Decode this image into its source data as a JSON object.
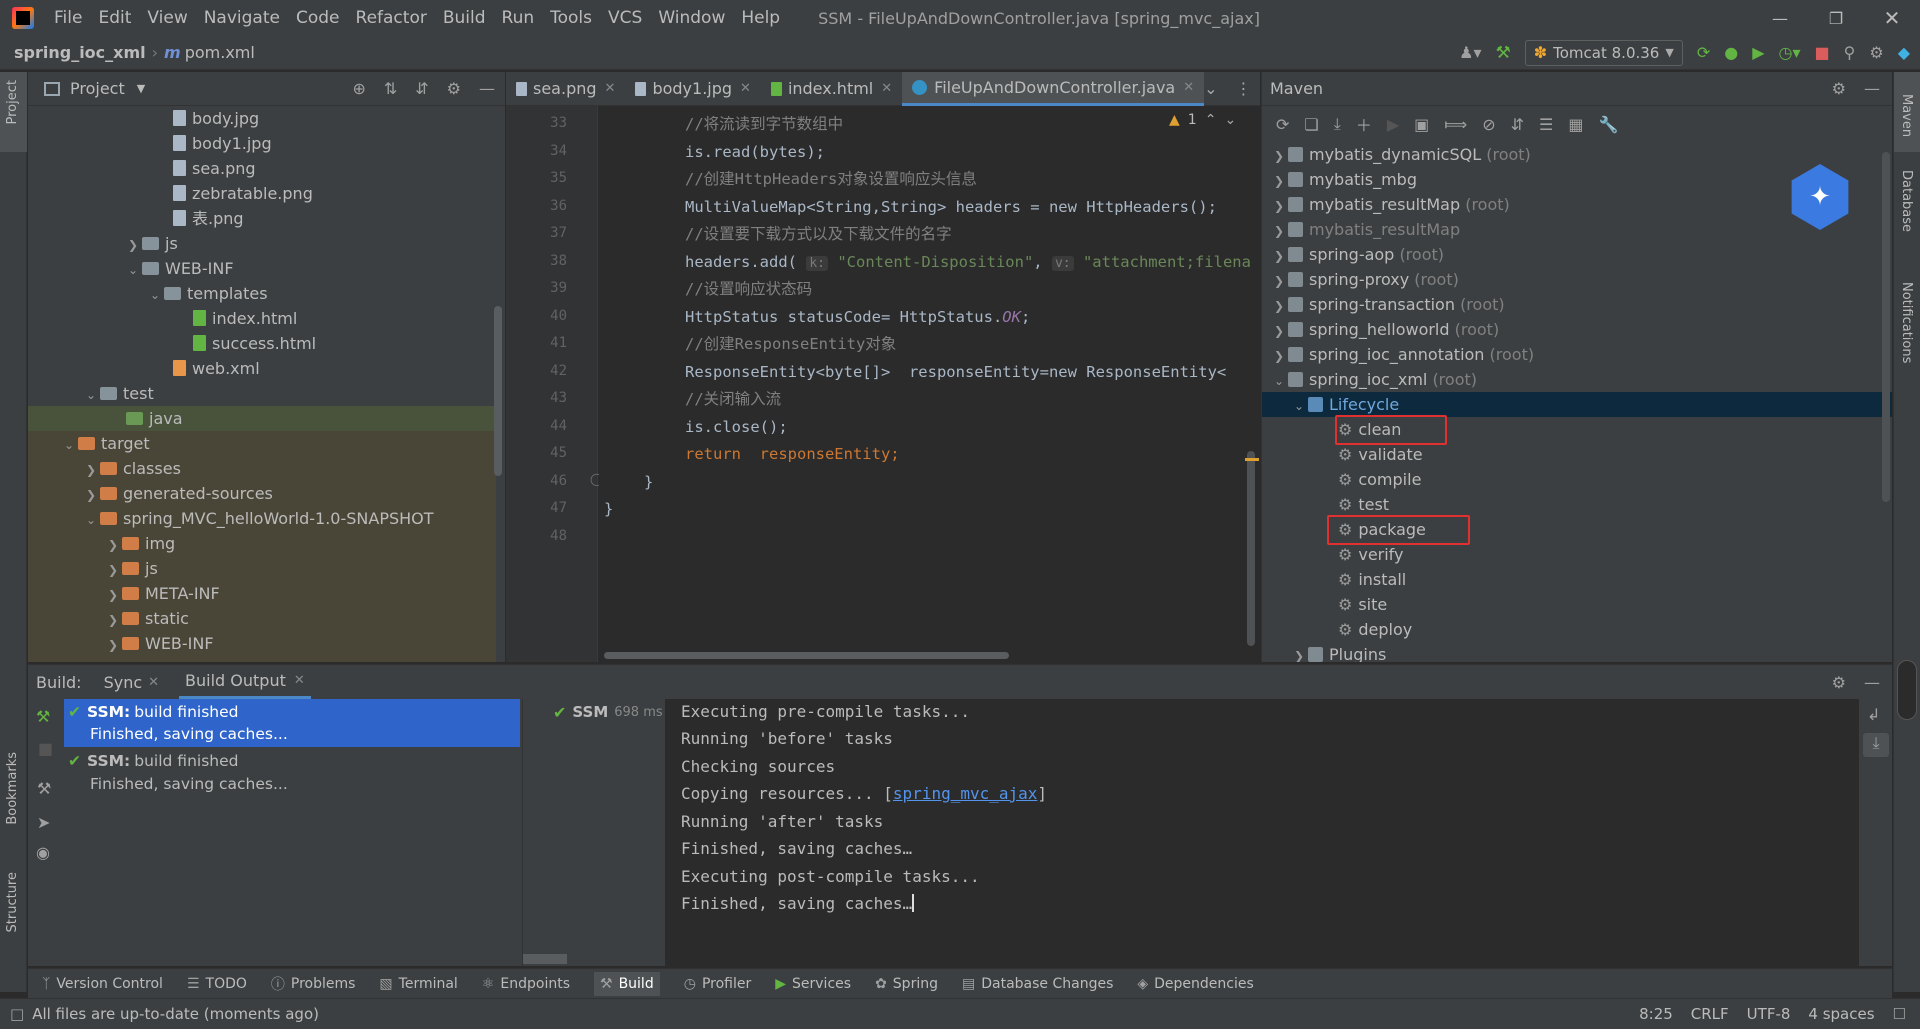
{
  "window": {
    "title": "SSM - FileUpAndDownController.java [spring_mvc_ajax]"
  },
  "menu": [
    "File",
    "Edit",
    "View",
    "Navigate",
    "Code",
    "Refactor",
    "Build",
    "Run",
    "Tools",
    "VCS",
    "Window",
    "Help"
  ],
  "breadcrumb": {
    "project": "spring_ioc_xml",
    "file": "pom.xml"
  },
  "run_config": "Tomcat 8.0.36",
  "project_panel": {
    "title": "Project",
    "tree": [
      {
        "label": "body.jpg",
        "kind": "file"
      },
      {
        "label": "body1.jpg",
        "kind": "file"
      },
      {
        "label": "sea.png",
        "kind": "file"
      },
      {
        "label": "zebratable.png",
        "kind": "file"
      },
      {
        "label": "表.png",
        "kind": "file"
      },
      {
        "label": "js",
        "kind": "folder"
      },
      {
        "label": "WEB-INF",
        "kind": "folder"
      },
      {
        "label": "templates",
        "kind": "folder"
      },
      {
        "label": "index.html",
        "kind": "html"
      },
      {
        "label": "success.html",
        "kind": "html"
      },
      {
        "label": "web.xml",
        "kind": "file"
      },
      {
        "label": "test",
        "kind": "folder"
      },
      {
        "label": "java",
        "kind": "folder"
      },
      {
        "label": "target",
        "kind": "folder"
      },
      {
        "label": "classes",
        "kind": "folder"
      },
      {
        "label": "generated-sources",
        "kind": "folder"
      },
      {
        "label": "spring_MVC_helloWorld-1.0-SNAPSHOT",
        "kind": "folder"
      },
      {
        "label": "img",
        "kind": "folder"
      },
      {
        "label": "js",
        "kind": "folder"
      },
      {
        "label": "META-INF",
        "kind": "folder"
      },
      {
        "label": "static",
        "kind": "folder"
      },
      {
        "label": "WEB-INF",
        "kind": "folder"
      }
    ]
  },
  "editor": {
    "tabs": [
      "sea.png",
      "body1.jpg",
      "index.html",
      "FileUpAndDownController.java"
    ],
    "active_tab": "FileUpAndDownController.java",
    "warning_count": "1",
    "line_numbers": [
      "33",
      "34",
      "35",
      "36",
      "37",
      "38",
      "39",
      "40",
      "41",
      "42",
      "43",
      "44",
      "45",
      "46",
      "47",
      "48"
    ],
    "lines": [
      "//将流读到字节数组中",
      "is.read(bytes);",
      "//创建HttpHeaders对象设置响应头信息",
      "MultiValueMap<String,String> headers = new HttpHeaders();",
      "//设置要下载方式以及下载文件的名字",
      "headers.add(",
      "//设置响应状态码",
      "HttpStatus statusCode= HttpStatus.",
      "//创建ResponseEntity对象",
      "ResponseEntity<byte[]>  responseEntity=new ResponseEntity<",
      "//关闭输入流",
      "is.close();",
      "return  responseEntity;",
      "}",
      "}"
    ],
    "hint_k": "k:",
    "hint_v": "v:",
    "str_disposition": "\"Content-Disposition\"",
    "str_attachment": "\"attachment;filena",
    "ok_const": "OK"
  },
  "maven": {
    "title": "Maven",
    "projects": [
      {
        "name": "mybatis_dynamicSQL",
        "suffix": "(root)"
      },
      {
        "name": "mybatis_mbg",
        "suffix": ""
      },
      {
        "name": "mybatis_resultMap",
        "suffix": "(root)"
      },
      {
        "name": "mybatis_resultMap",
        "suffix": ""
      },
      {
        "name": "spring-aop",
        "suffix": "(root)"
      },
      {
        "name": "spring-proxy",
        "suffix": "(root)"
      },
      {
        "name": "spring-transaction",
        "suffix": "(root)"
      },
      {
        "name": "spring_helloworld",
        "suffix": "(root)"
      },
      {
        "name": "spring_ioc_annotation",
        "suffix": "(root)"
      },
      {
        "name": "spring_ioc_xml",
        "suffix": "(root)"
      }
    ],
    "lifecycle_label": "Lifecycle",
    "lifecycle": [
      "clean",
      "validate",
      "compile",
      "test",
      "package",
      "verify",
      "install",
      "site",
      "deploy"
    ],
    "plugins_label": "Plugins"
  },
  "build": {
    "label": "Build:",
    "tabs": [
      "Sync",
      "Build Output"
    ],
    "entries": [
      {
        "title": "SSM:",
        "status": "build finished",
        "detail": "Finished, saving caches..."
      },
      {
        "title": "SSM:",
        "status": "build finished",
        "detail": "Finished, saving caches..."
      }
    ],
    "summary_name": "SSM",
    "summary_time": "698 ms",
    "console": [
      "Executing pre-compile tasks...",
      "Running 'before' tasks",
      "Checking sources",
      "Copying resources... [",
      "Running 'after' tasks",
      "Finished, saving caches…",
      "Executing post-compile tasks...",
      "Finished, saving caches…"
    ],
    "console_link": "spring_mvc_ajax"
  },
  "tool_windows": [
    "Version Control",
    "TODO",
    "Problems",
    "Terminal",
    "Endpoints",
    "Build",
    "Profiler",
    "Services",
    "Spring",
    "Database Changes",
    "Dependencies"
  ],
  "side_labels": {
    "project": "Project",
    "bookmarks": "Bookmarks",
    "structure": "Structure",
    "maven": "Maven",
    "database": "Database",
    "notifications": "Notifications"
  },
  "status": {
    "message": "All files are up-to-date (moments ago)",
    "position": "8:25",
    "line_sep": "CRLF",
    "encoding": "UTF-8",
    "indent": "4 spaces"
  },
  "colors": {
    "accent": "#4a88c7",
    "selection": "#2f65ca",
    "redbox": "#e0302f"
  }
}
